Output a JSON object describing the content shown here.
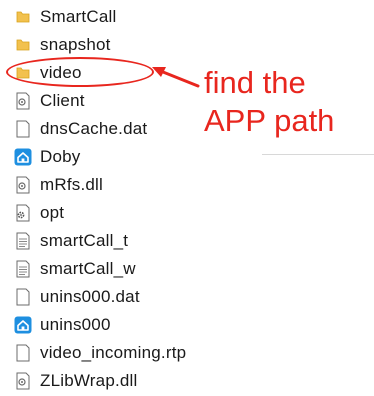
{
  "files": [
    {
      "name": "SmartCall",
      "icon": "folder-icon"
    },
    {
      "name": "snapshot",
      "icon": "folder-icon"
    },
    {
      "name": "video",
      "icon": "folder-icon"
    },
    {
      "name": "Client",
      "icon": "settings-file-icon"
    },
    {
      "name": "dnsCache.dat",
      "icon": "blank-file-icon"
    },
    {
      "name": "Doby",
      "icon": "app-house-icon"
    },
    {
      "name": "mRfs.dll",
      "icon": "settings-file-icon"
    },
    {
      "name": "opt",
      "icon": "gear-file-icon"
    },
    {
      "name": "smartCall_t",
      "icon": "text-file-icon"
    },
    {
      "name": "smartCall_w",
      "icon": "text-file-icon"
    },
    {
      "name": "unins000.dat",
      "icon": "blank-file-icon"
    },
    {
      "name": "unins000",
      "icon": "app-house-icon"
    },
    {
      "name": "video_incoming.rtp",
      "icon": "blank-file-icon"
    },
    {
      "name": "ZLibWrap.dll",
      "icon": "settings-file-icon"
    }
  ],
  "annotation": {
    "line1": "find the",
    "line2": "APP path",
    "color": "#e8261e"
  },
  "colors": {
    "folder": "#f2c14e",
    "folder_dark": "#d9a21c",
    "app_blue": "#1e8fe0",
    "file_border": "#6b6b6b"
  }
}
